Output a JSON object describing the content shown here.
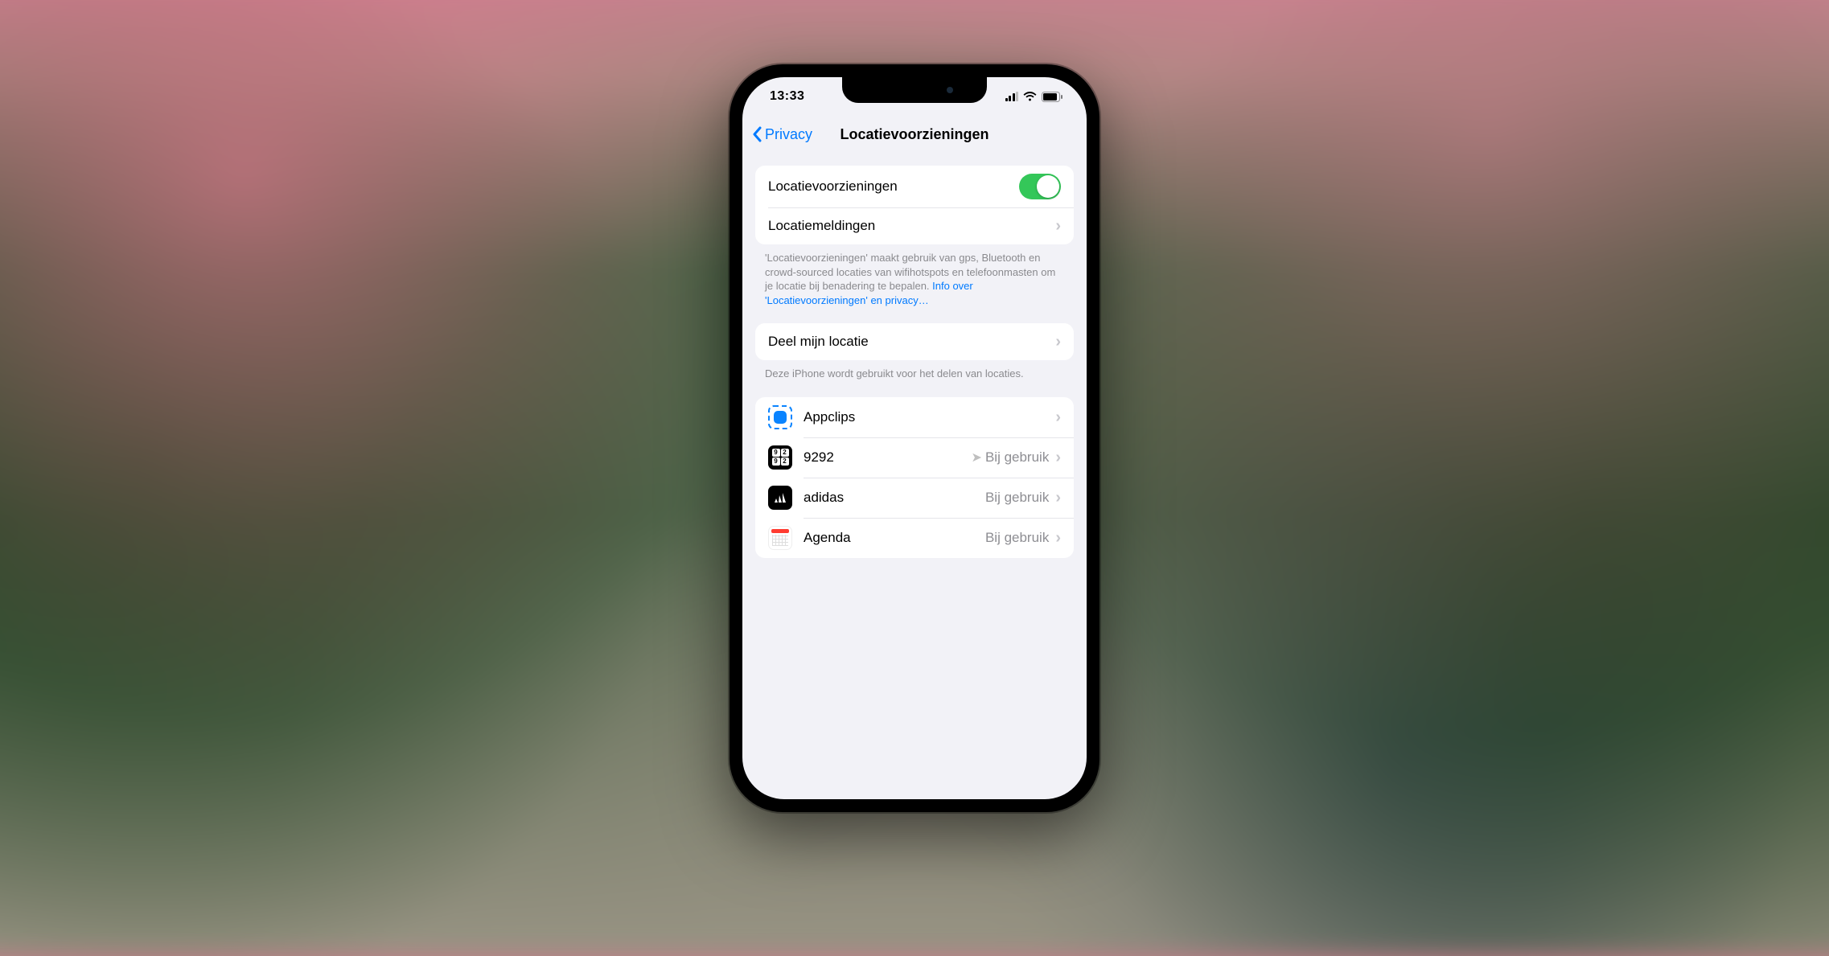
{
  "status": {
    "time": "13:33"
  },
  "nav": {
    "back_label": "Privacy",
    "title": "Locatievoorzieningen"
  },
  "section1": {
    "toggle_label": "Locatievoorzieningen",
    "notifications_label": "Locatiemeldingen"
  },
  "footer1": {
    "text": "'Locatievoorzieningen' maakt gebruik van gps, Bluetooth en crowd-sourced locaties van wifihotspots en telefoonmasten om je locatie bij benadering te bepalen. ",
    "link": "Info over 'Locatievoorzieningen' en privacy…"
  },
  "section2": {
    "share_label": "Deel mijn locatie"
  },
  "footer2": {
    "text": "Deze iPhone wordt gebruikt voor het delen van locaties."
  },
  "apps": [
    {
      "name": "Appclips",
      "status": "",
      "arrow": false,
      "icon": "appclips"
    },
    {
      "name": "9292",
      "status": "Bij gebruik",
      "arrow": true,
      "icon": "9292"
    },
    {
      "name": "adidas",
      "status": "Bij gebruik",
      "arrow": false,
      "icon": "adidas"
    },
    {
      "name": "Agenda",
      "status": "Bij gebruik",
      "arrow": false,
      "icon": "agenda"
    }
  ]
}
